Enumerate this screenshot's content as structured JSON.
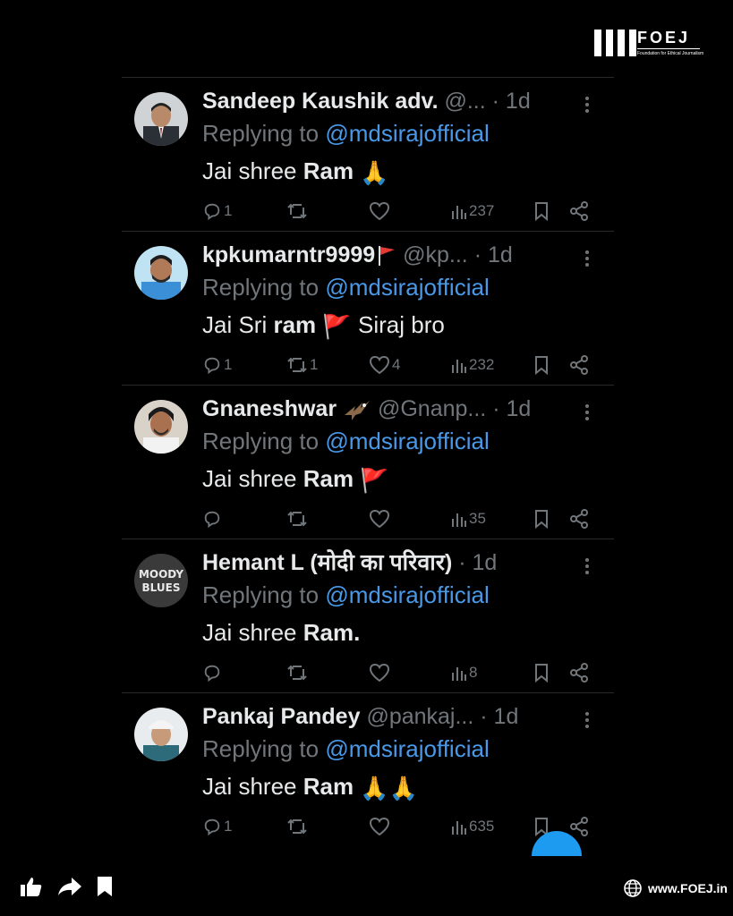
{
  "brand": {
    "name": "FOEJ",
    "tagline": "Foundation for Ethical Journalism",
    "website": "www.FOEJ.in"
  },
  "tweets": [
    {
      "name": "Sandeep Kaushik adv.",
      "handle": "@...",
      "time": "· 1d",
      "replying_prefix": "Replying to ",
      "mention": "@mdsirajofficial",
      "body_pre": "Jai shree ",
      "body_bold": "Ram",
      "body_post": "",
      "emoji": "🙏",
      "replies": "1",
      "retweets": "",
      "likes": "",
      "views": "237"
    },
    {
      "name": "kpkumarntr9999",
      "handle": "@kp...",
      "time": "· 1d",
      "replying_prefix": "Replying to ",
      "mention": "@mdsirajofficial",
      "body_pre": "Jai Sri ",
      "body_bold": "ram",
      "body_post": " Siraj bro",
      "emoji": "🚩",
      "replies": "1",
      "retweets": "1",
      "likes": "4",
      "views": "232"
    },
    {
      "name": "Gnaneshwar",
      "handle": "@Gnanp...",
      "time": "· 1d",
      "replying_prefix": "Replying to ",
      "mention": "@mdsirajofficial",
      "body_pre": "Jai shree ",
      "body_bold": "Ram",
      "body_post": "",
      "emoji": "🚩",
      "replies": "",
      "retweets": "",
      "likes": "",
      "views": "35"
    },
    {
      "name": "Hemant L (मोदी का परिवार)",
      "handle": "",
      "time": "· 1d",
      "replying_prefix": "Replying to ",
      "mention": "@mdsirajofficial",
      "body_pre": "Jai shree ",
      "body_bold": "Ram.",
      "body_post": "",
      "emoji": "",
      "replies": "",
      "retweets": "",
      "likes": "",
      "views": "8"
    },
    {
      "name": "Pankaj Pandey",
      "handle": "@pankaj...",
      "time": "· 1d",
      "replying_prefix": "Replying to ",
      "mention": "@mdsirajofficial",
      "body_pre": "Jai shree ",
      "body_bold": "Ram",
      "body_post": "",
      "emoji": "🙏🙏",
      "replies": "1",
      "retweets": "",
      "likes": "",
      "views": "635"
    }
  ],
  "avatar_texts": {
    "t4": "MOODY BLUES"
  },
  "colors": {
    "mention": "#4a99e9",
    "muted": "#71767b",
    "text": "#e7e9ea"
  }
}
